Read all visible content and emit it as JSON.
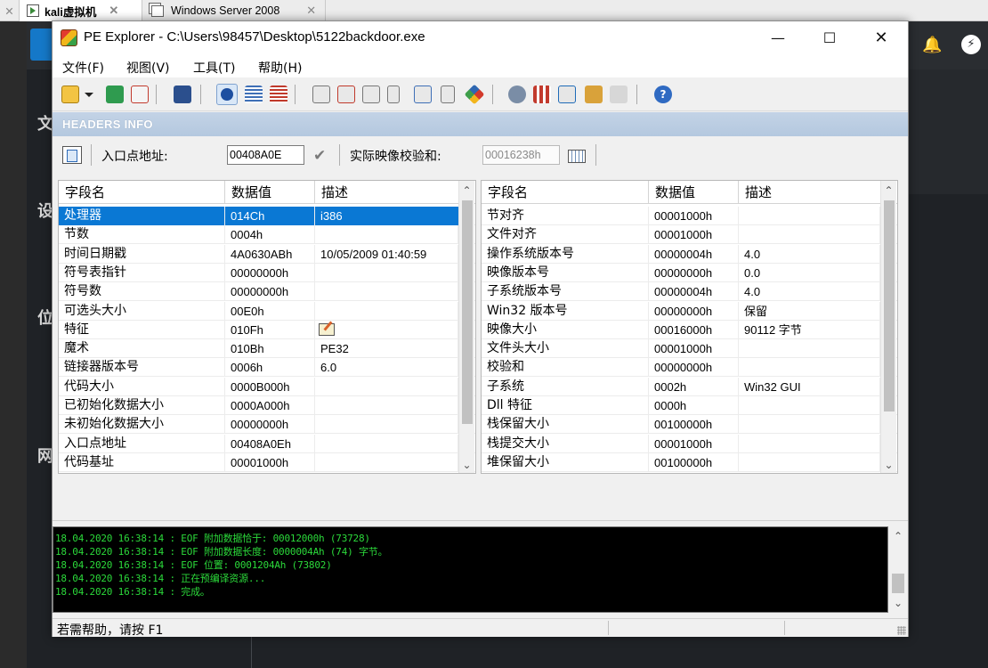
{
  "host": {
    "tabs": [
      {
        "label": "kali虚拟机",
        "active": true
      },
      {
        "label": "Windows Server 2008",
        "active": false
      }
    ],
    "side_chars": [
      "文",
      "设",
      "位",
      "网"
    ]
  },
  "window": {
    "title": "PE Explorer - C:\\Users\\98457\\Desktop\\5122backdoor.exe",
    "minimize": "—",
    "maximize": "☐",
    "close": "✕"
  },
  "menu": [
    "文件(F)",
    "视图(V)",
    "工具(T)",
    "帮助(H)"
  ],
  "toolbar": {
    "icons": [
      "open-icon",
      "dropdown-icon",
      "refresh-icon",
      "close-file-icon",
      "save-icon",
      "headers-info-icon",
      "data-directories-icon",
      "section-headers-icon",
      "export-icon",
      "import-icon",
      "resources-icon",
      "debug-icon",
      "dependency-icon",
      "disassembler-icon",
      "resource-editor-icon",
      "tools-icon",
      "syntax-icon",
      "help-icon"
    ]
  },
  "headers_info": {
    "title": "HEADERS INFO",
    "entry_point_label": "入口点地址:",
    "entry_point_value": "00408A0E",
    "checksum_label": "实际映像校验和:",
    "checksum_value": "00016238h"
  },
  "left_table": {
    "columns": [
      "字段名",
      "数据值",
      "描述"
    ],
    "rows": [
      {
        "field": "处理器",
        "value": "014Ch",
        "desc": "i386",
        "selected": true
      },
      {
        "field": "节数",
        "value": "0004h",
        "desc": ""
      },
      {
        "field": "时间日期戳",
        "value": "4A0630ABh",
        "desc": "10/05/2009 01:40:59"
      },
      {
        "field": "符号表指针",
        "value": "00000000h",
        "desc": ""
      },
      {
        "field": "符号数",
        "value": "00000000h",
        "desc": ""
      },
      {
        "field": "可选头大小",
        "value": "00E0h",
        "desc": ""
      },
      {
        "field": "特征",
        "value": "010Fh",
        "desc": ""
      },
      {
        "field": "魔术",
        "value": "010Bh",
        "desc": "PE32"
      },
      {
        "field": "链接器版本号",
        "value": "0006h",
        "desc": "6.0"
      },
      {
        "field": "代码大小",
        "value": "0000B000h",
        "desc": ""
      },
      {
        "field": "已初始化数据大小",
        "value": "0000A000h",
        "desc": ""
      },
      {
        "field": "未初始化数据大小",
        "value": "00000000h",
        "desc": ""
      },
      {
        "field": "入口点地址",
        "value": "00408A0Eh",
        "desc": ""
      },
      {
        "field": "代码基址",
        "value": "00001000h",
        "desc": ""
      }
    ]
  },
  "right_table": {
    "columns": [
      "字段名",
      "数据值",
      "描述"
    ],
    "rows": [
      {
        "field": "节对齐",
        "value": "00001000h",
        "desc": ""
      },
      {
        "field": "文件对齐",
        "value": "00001000h",
        "desc": ""
      },
      {
        "field": "操作系统版本号",
        "value": "00000004h",
        "desc": "4.0"
      },
      {
        "field": "映像版本号",
        "value": "00000000h",
        "desc": "0.0"
      },
      {
        "field": "子系统版本号",
        "value": "00000004h",
        "desc": "4.0"
      },
      {
        "field": "Win32 版本号",
        "value": "00000000h",
        "desc": "保留"
      },
      {
        "field": "映像大小",
        "value": "00016000h",
        "desc": "90112 字节"
      },
      {
        "field": "文件头大小",
        "value": "00001000h",
        "desc": ""
      },
      {
        "field": "校验和",
        "value": "00000000h",
        "desc": ""
      },
      {
        "field": "子系统",
        "value": "0002h",
        "desc": "Win32 GUI"
      },
      {
        "field": "Dll 特征",
        "value": "0000h",
        "desc": ""
      },
      {
        "field": "栈保留大小",
        "value": "00100000h",
        "desc": ""
      },
      {
        "field": "栈提交大小",
        "value": "00001000h",
        "desc": ""
      },
      {
        "field": "堆保留大小",
        "value": "00100000h",
        "desc": ""
      }
    ]
  },
  "log": [
    "18.04.2020 16:38:14 : EOF 附加数据恰于: 00012000h  (73728)",
    "18.04.2020 16:38:14 : EOF 附加数据长度: 0000004Ah  (74) 字节。",
    "18.04.2020 16:38:14 : EOF 位置: 0001204Ah  (73802)",
    "18.04.2020 16:38:14 : 正在预编译资源...",
    "18.04.2020 16:38:14 : 完成。"
  ],
  "status": "若需帮助，请按 F1",
  "colors": {
    "selection": "#0a78d4",
    "log_text": "#2bd93a",
    "header_bar": "#b4c8df"
  }
}
